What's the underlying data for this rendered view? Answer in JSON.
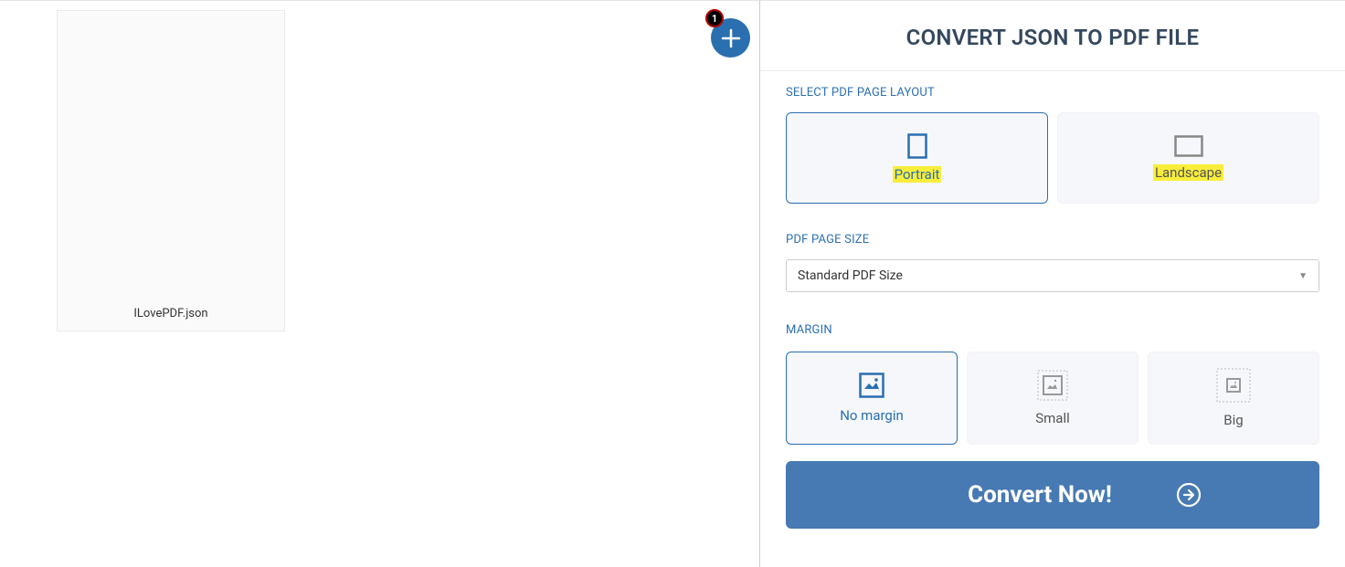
{
  "leftPanel": {
    "fileName": "ILovePDF.json",
    "addBadgeCount": "1"
  },
  "rightPanel": {
    "title": "CONVERT JSON TO PDF FILE",
    "layout": {
      "label": "SELECT PDF PAGE LAYOUT",
      "portrait": "Portrait",
      "landscape": "Landscape"
    },
    "pageSize": {
      "label": "PDF PAGE SIZE",
      "selected": "Standard PDF Size"
    },
    "margin": {
      "label": "MARGIN",
      "none": "No margin",
      "small": "Small",
      "big": "Big"
    },
    "convertLabel": "Convert Now!"
  }
}
